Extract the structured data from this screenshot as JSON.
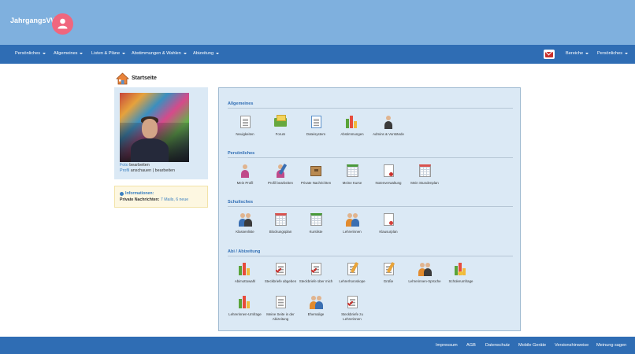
{
  "brand": "JahrgangsVW",
  "nav": {
    "left": [
      "Persönliches",
      "Allgemeines",
      "Listen & Pläne",
      "Abstimmungen & Wahlen",
      "Abizeitung"
    ],
    "right": [
      "Bereiche",
      "Persönliches"
    ]
  },
  "page_title": "Startseite",
  "profile": {
    "line1_link": "Foto",
    "line1_text": "bearbeiten",
    "line2_link": "Profil",
    "line2_text": "anschauen | bearbeiten"
  },
  "info": {
    "title": "Informationen:",
    "label": "Private Nachrichten:",
    "value": "7 Mails, 6 neue"
  },
  "sections": [
    {
      "title": "Allgemeines",
      "items": [
        {
          "label": "Neuigkeiten",
          "icon": "newspaper-icon"
        },
        {
          "label": "Forum",
          "icon": "forum-icon"
        },
        {
          "label": "Dateisystem",
          "icon": "file-system-icon"
        },
        {
          "label": "Abstimmungen",
          "icon": "bar-chart-icon"
        },
        {
          "label": "Admins & Vorstände",
          "icon": "admin-icon"
        }
      ]
    },
    {
      "title": "Persönliches",
      "items": [
        {
          "label": "Mein Profil",
          "icon": "profile-icon"
        },
        {
          "label": "Profil bearbeiten",
          "icon": "profile-edit-icon"
        },
        {
          "label": "Private Nachrichten",
          "icon": "mailbox-icon"
        },
        {
          "label": "Meine Kurse",
          "icon": "course-sheet-icon"
        },
        {
          "label": "Notenverwaltung",
          "icon": "grades-icon"
        },
        {
          "label": "Mein Stundenplan",
          "icon": "timetable-icon"
        }
      ]
    },
    {
      "title": "Schulisches",
      "items": [
        {
          "label": "Klassenliste",
          "icon": "class-list-icon"
        },
        {
          "label": "Blockungsplan",
          "icon": "block-plan-icon"
        },
        {
          "label": "Kursliste",
          "icon": "course-list-icon"
        },
        {
          "label": "Lehrerinnen",
          "icon": "teachers-icon"
        },
        {
          "label": "Klausurplan",
          "icon": "exam-plan-icon"
        }
      ]
    },
    {
      "title": "Abi / Abizeitung",
      "items": [
        {
          "label": "Abimottowahl",
          "icon": "motto-vote-icon"
        },
        {
          "label": "Steckbriefe abgeben",
          "icon": "profile-submit-icon"
        },
        {
          "label": "Steckbriefe über mich",
          "icon": "profile-about-me-icon"
        },
        {
          "label": "Lehrerhoroskope",
          "icon": "teacher-horoscope-icon"
        },
        {
          "label": "Grüße",
          "icon": "greetings-icon"
        },
        {
          "label": "Lehrerinnen-Sprüche",
          "icon": "teacher-quotes-icon"
        },
        {
          "label": "Schülerumfrage",
          "icon": "student-survey-icon"
        },
        {
          "label": "Lehrerinnen-Umfrage",
          "icon": "teacher-survey-icon"
        },
        {
          "label": "Meine Seite in der Abizeitung",
          "icon": "my-page-icon"
        },
        {
          "label": "Ehemalige",
          "icon": "alumni-icon"
        },
        {
          "label": "Steckbriefe zu Lehrerinnen",
          "icon": "teacher-profiles-icon"
        }
      ]
    }
  ],
  "footer": [
    "Impressum",
    "AGB",
    "Datenschutz",
    "Mobile Geräte",
    "Versionshinweise",
    "Meinung sagen"
  ]
}
